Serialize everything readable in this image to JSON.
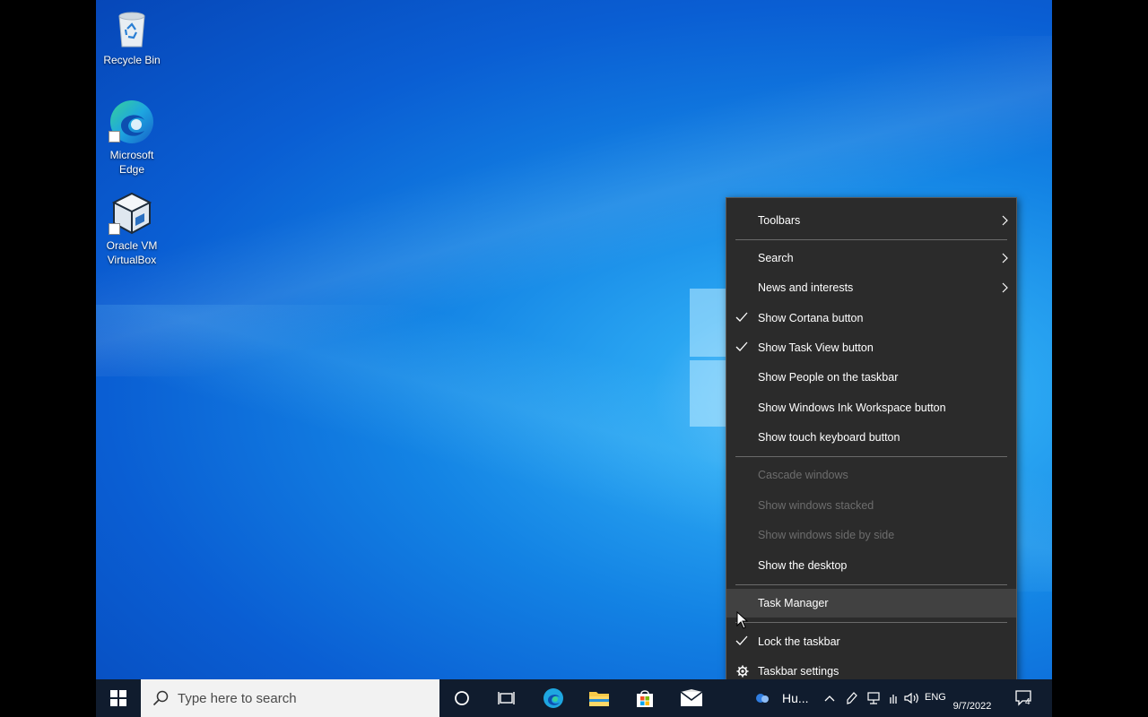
{
  "desktop": {
    "icons": [
      {
        "label": "Recycle Bin",
        "icon": "recycle-bin-icon"
      },
      {
        "label": "Microsoft Edge",
        "icon": "edge-icon"
      },
      {
        "label": "Oracle VM VirtualBox",
        "icon": "virtualbox-icon"
      }
    ]
  },
  "context_menu": {
    "items": [
      {
        "label": "Toolbars",
        "submenu": true
      },
      {
        "label": "Search",
        "submenu": true
      },
      {
        "label": "News and interests",
        "submenu": true
      },
      {
        "label": "Show Cortana button",
        "checked": true
      },
      {
        "label": "Show Task View button",
        "checked": true
      },
      {
        "label": "Show People on the taskbar"
      },
      {
        "label": "Show Windows Ink Workspace button"
      },
      {
        "label": "Show touch keyboard button"
      },
      {
        "label": "Cascade windows",
        "disabled": true
      },
      {
        "label": "Show windows stacked",
        "disabled": true
      },
      {
        "label": "Show windows side by side",
        "disabled": true
      },
      {
        "label": "Show the desktop"
      },
      {
        "label": "Task Manager",
        "hovered": true
      },
      {
        "label": "Lock the taskbar",
        "checked": true
      },
      {
        "label": "Taskbar settings",
        "icon": "gear-icon"
      }
    ]
  },
  "taskbar": {
    "search_placeholder": "Type here to search",
    "weather_label": "Hu...",
    "language": "ENG",
    "date": "9/7/2022",
    "notification_count": "4"
  },
  "colors": {
    "menu_bg": "#2b2b2b",
    "menu_hover": "#414141",
    "taskbar_bg": "#101c2e",
    "desktop_accent": "#1383e4"
  }
}
